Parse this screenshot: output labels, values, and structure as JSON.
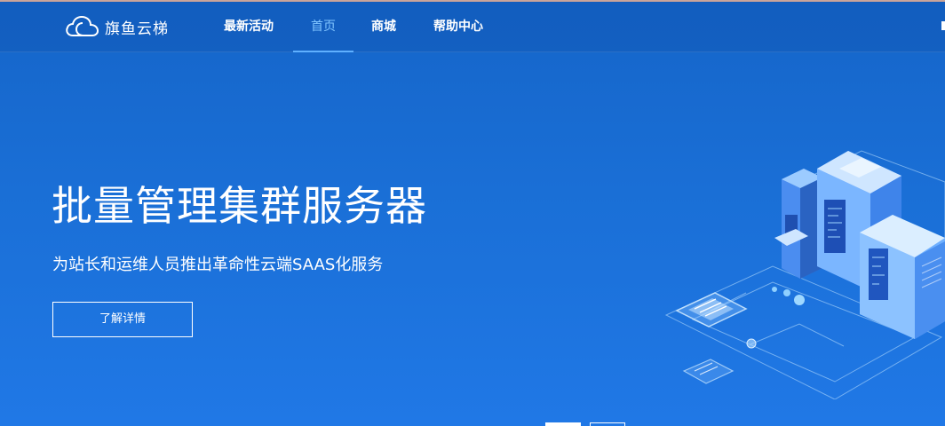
{
  "brand": {
    "name": "旗鱼云梯",
    "logo_icon": "cloud-icon"
  },
  "nav": {
    "items": [
      {
        "label": "最新活动",
        "active": false
      },
      {
        "label": "首页",
        "active": true
      },
      {
        "label": "商城",
        "active": false
      },
      {
        "label": "帮助中心",
        "active": false
      }
    ]
  },
  "hero": {
    "title": "批量管理集群服务器",
    "subtitle": "为站长和运维人员推出革命性云端SAAS化服务",
    "cta_label": "了解详情"
  },
  "carousel": {
    "slide_count": 2,
    "active_index": 0
  },
  "colors": {
    "background_top": "#1565c9",
    "background_bottom": "#2078e6",
    "nav_active": "#7fc4ff",
    "text": "#ffffff"
  }
}
